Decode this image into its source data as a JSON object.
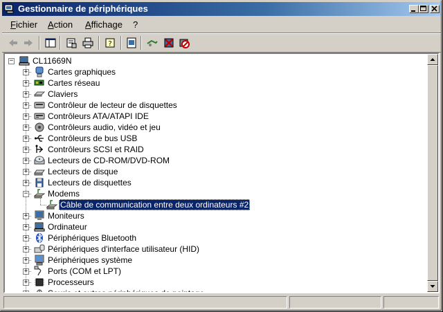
{
  "window": {
    "title": "Gestionnaire de périphériques"
  },
  "menubar": {
    "items": [
      "Fichier",
      "Action",
      "Affichage",
      "?"
    ]
  },
  "toolbar": {
    "buttons": [
      "back",
      "forward",
      "show-hide-console-tree",
      "properties",
      "print",
      "help",
      "update-driver",
      "scan-hardware",
      "uninstall",
      "disable"
    ]
  },
  "tree": {
    "root": "CL11669N",
    "nodes": [
      {
        "label": "Cartes graphiques",
        "icon": "display-adapter-icon",
        "expanded": false
      },
      {
        "label": "Cartes réseau",
        "icon": "network-card-icon",
        "expanded": false
      },
      {
        "label": "Claviers",
        "icon": "keyboard-icon",
        "expanded": false
      },
      {
        "label": "Contrôleur de lecteur de disquettes",
        "icon": "floppy-controller-icon",
        "expanded": false
      },
      {
        "label": "Contrôleurs ATA/ATAPI IDE",
        "icon": "ide-controller-icon",
        "expanded": false
      },
      {
        "label": "Contrôleurs audio, vidéo et jeu",
        "icon": "audio-icon",
        "expanded": false
      },
      {
        "label": "Contrôleurs de bus USB",
        "icon": "usb-icon",
        "expanded": false
      },
      {
        "label": "Contrôleurs SCSI et RAID",
        "icon": "scsi-icon",
        "expanded": false
      },
      {
        "label": "Lecteurs de CD-ROM/DVD-ROM",
        "icon": "cdrom-icon",
        "expanded": false
      },
      {
        "label": "Lecteurs de disque",
        "icon": "disk-drive-icon",
        "expanded": false
      },
      {
        "label": "Lecteurs de disquettes",
        "icon": "floppy-drive-icon",
        "expanded": false
      },
      {
        "label": "Modems",
        "icon": "modem-icon",
        "expanded": true,
        "children": [
          {
            "label": "Câble de communication entre deux ordinateurs #2",
            "icon": "modem-icon",
            "selected": true
          }
        ]
      },
      {
        "label": "Moniteurs",
        "icon": "monitor-icon",
        "expanded": false
      },
      {
        "label": "Ordinateur",
        "icon": "computer-icon",
        "expanded": false
      },
      {
        "label": "Périphériques Bluetooth",
        "icon": "bluetooth-icon",
        "expanded": false
      },
      {
        "label": "Périphériques d'interface utilisateur (HID)",
        "icon": "hid-icon",
        "expanded": false
      },
      {
        "label": "Périphériques système",
        "icon": "system-device-icon",
        "expanded": false
      },
      {
        "label": "Ports (COM et LPT)",
        "icon": "port-icon",
        "expanded": false
      },
      {
        "label": "Processeurs",
        "icon": "processor-icon",
        "expanded": false
      },
      {
        "label": "Souris et autres périphériques de pointage",
        "icon": "mouse-icon",
        "expanded": false
      }
    ]
  },
  "colors": {
    "titlebar_start": "#0a246a",
    "titlebar_end": "#a6caf0",
    "selection": "#0a246a",
    "face": "#d4d0c8"
  }
}
